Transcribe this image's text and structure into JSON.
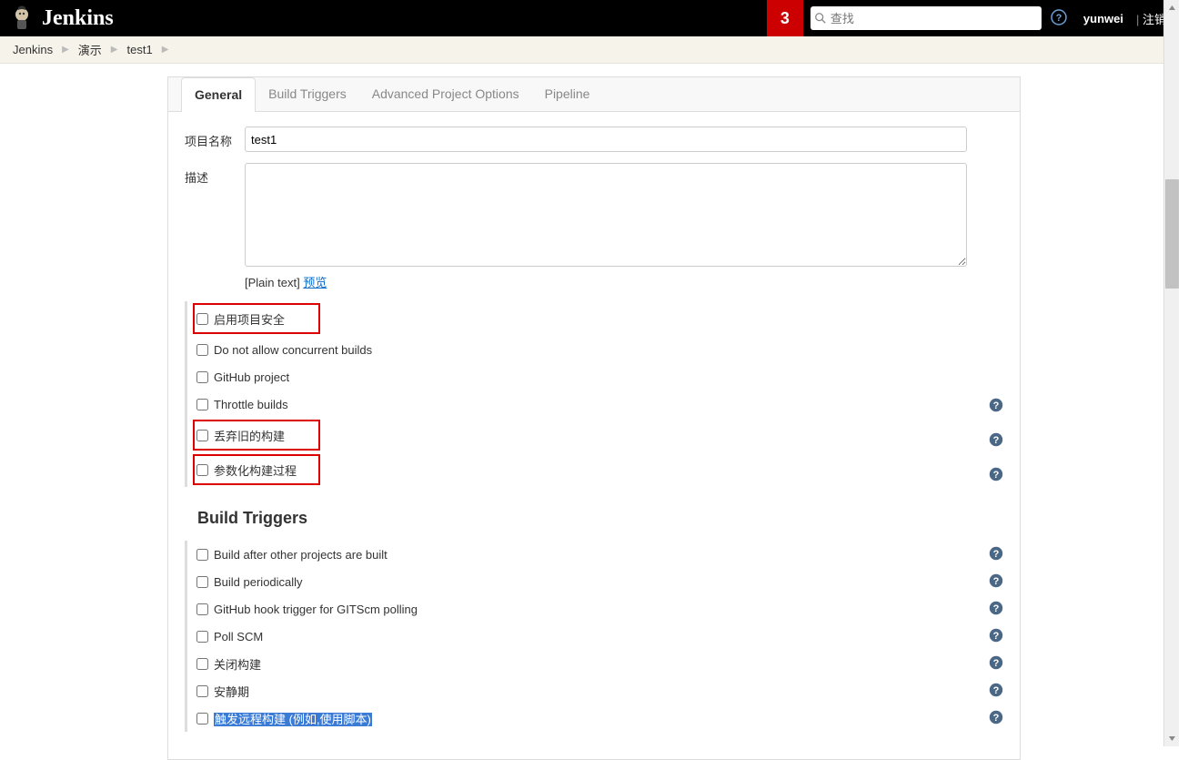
{
  "header": {
    "app_name": "Jenkins",
    "notif_count": "3",
    "search_placeholder": "查找",
    "user_name": "yunwei",
    "logout_label": "注销"
  },
  "breadcrumb": {
    "items": [
      "Jenkins",
      "演示",
      "test1"
    ]
  },
  "tabs": {
    "items": [
      "General",
      "Build Triggers",
      "Advanced Project Options",
      "Pipeline"
    ],
    "active_index": 0
  },
  "form": {
    "project_name_label": "项目名称",
    "project_name_value": "test1",
    "description_label": "描述",
    "description_value": "",
    "plain_text_label": "[Plain text]",
    "preview_label": "预览"
  },
  "general_options": [
    {
      "label": "启用项目安全",
      "checked": false,
      "highlight": true,
      "help": false
    },
    {
      "label": "Do not allow concurrent builds",
      "checked": false,
      "highlight": false,
      "help": false
    },
    {
      "label": "GitHub project",
      "checked": false,
      "highlight": false,
      "help": false
    },
    {
      "label": "Throttle builds",
      "checked": false,
      "highlight": false,
      "help": true
    },
    {
      "label": "丢弃旧的构建",
      "checked": false,
      "highlight": true,
      "help": true
    },
    {
      "label": "参数化构建过程",
      "checked": false,
      "highlight": true,
      "help": true
    }
  ],
  "build_triggers_title": "Build Triggers",
  "build_triggers": [
    {
      "label": "Build after other projects are built",
      "checked": false,
      "help": true,
      "selected": false
    },
    {
      "label": "Build periodically",
      "checked": false,
      "help": true,
      "selected": false
    },
    {
      "label": "GitHub hook trigger for GITScm polling",
      "checked": false,
      "help": true,
      "selected": false
    },
    {
      "label": "Poll SCM",
      "checked": false,
      "help": true,
      "selected": false
    },
    {
      "label": "关闭构建",
      "checked": false,
      "help": true,
      "selected": false
    },
    {
      "label": "安静期",
      "checked": false,
      "help": true,
      "selected": false
    },
    {
      "label": "触发远程构建 (例如,使用脚本)",
      "checked": false,
      "help": true,
      "selected": true
    }
  ]
}
